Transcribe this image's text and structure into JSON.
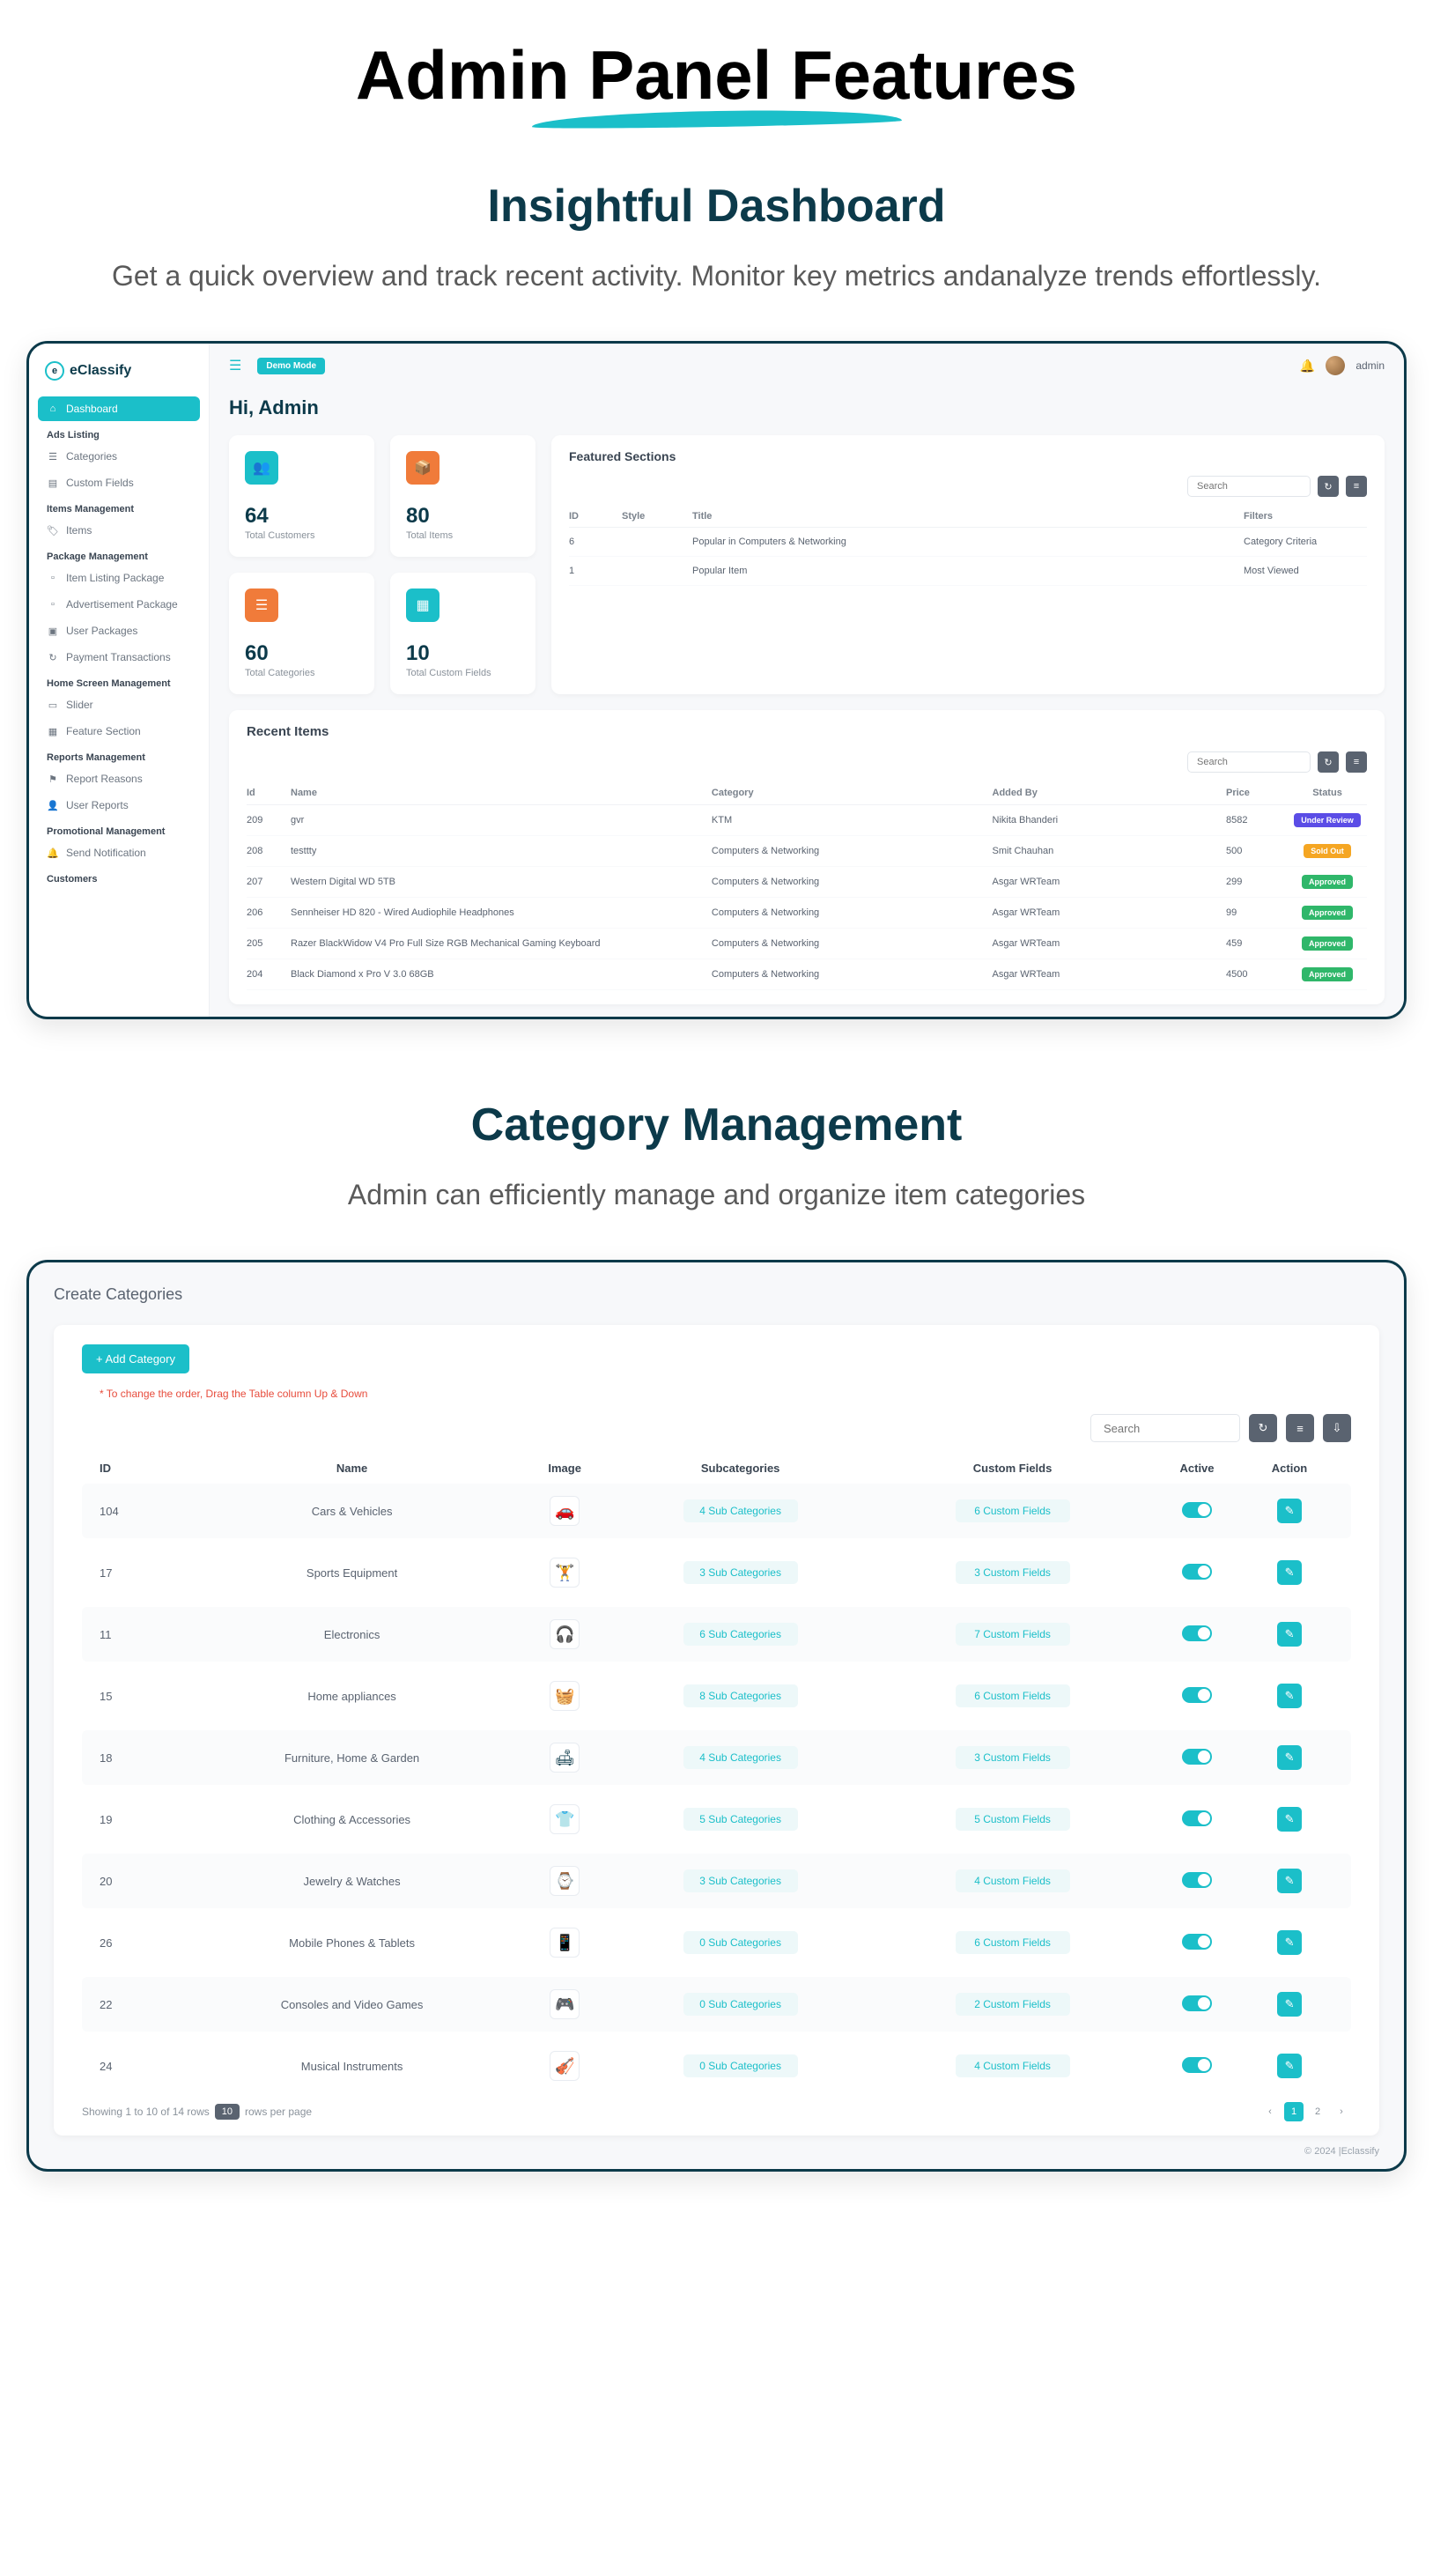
{
  "hero": "Admin Panel Features",
  "section1": {
    "title": "Insightful Dashboard",
    "sub": "Get a quick overview and track recent activity. Monitor key metrics andanalyze trends effortlessly."
  },
  "dashboard": {
    "logo": "eClassify",
    "demo": "Demo Mode",
    "admin": "admin",
    "sidebar": {
      "dashboard": "Dashboard",
      "h1": "Ads Listing",
      "categories": "Categories",
      "customFields": "Custom Fields",
      "h2": "Items Management",
      "items": "Items",
      "h3": "Package Management",
      "itemListing": "Item Listing Package",
      "adsPackage": "Advertisement Package",
      "userPackages": "User Packages",
      "payment": "Payment Transactions",
      "h4": "Home Screen Management",
      "slider": "Slider",
      "feature": "Feature Section",
      "h5": "Reports Management",
      "reportReasons": "Report Reasons",
      "userReports": "User Reports",
      "h6": "Promotional Management",
      "sendNotif": "Send Notification",
      "h7": "Customers"
    },
    "greeting": "Hi, Admin",
    "stats": {
      "customers": {
        "num": "64",
        "lbl": "Total Customers"
      },
      "items": {
        "num": "80",
        "lbl": "Total Items"
      },
      "categories": {
        "num": "60",
        "lbl": "Total Categories"
      },
      "customFields": {
        "num": "10",
        "lbl": "Total Custom Fields"
      }
    },
    "featured": {
      "title": "Featured Sections",
      "searchPh": "Search",
      "cols": {
        "id": "ID",
        "style": "Style",
        "title": "Title",
        "filters": "Filters"
      },
      "rows": [
        {
          "id": "6",
          "title": "Popular in Computers & Networking",
          "filters": "Category Criteria"
        },
        {
          "id": "1",
          "title": "Popular Item",
          "filters": "Most Viewed"
        }
      ]
    },
    "recent": {
      "title": "Recent Items",
      "searchPh": "Search",
      "cols": {
        "id": "Id",
        "name": "Name",
        "category": "Category",
        "by": "Added By",
        "price": "Price",
        "status": "Status"
      },
      "rows": [
        {
          "id": "209",
          "name": "gvr",
          "cat": "KTM",
          "by": "Nikita Bhanderi",
          "price": "8582",
          "status": "Under Review",
          "cls": "b-review"
        },
        {
          "id": "208",
          "name": "testtty",
          "cat": "Computers & Networking",
          "by": "Smit Chauhan",
          "price": "500",
          "status": "Sold Out",
          "cls": "b-soldout"
        },
        {
          "id": "207",
          "name": "Western Digital WD 5TB",
          "cat": "Computers & Networking",
          "by": "Asgar WRTeam",
          "price": "299",
          "status": "Approved",
          "cls": "b-approved"
        },
        {
          "id": "206",
          "name": "Sennheiser HD 820 - Wired Audiophile Headphones",
          "cat": "Computers & Networking",
          "by": "Asgar WRTeam",
          "price": "99",
          "status": "Approved",
          "cls": "b-approved"
        },
        {
          "id": "205",
          "name": "Razer BlackWidow V4 Pro Full Size RGB Mechanical Gaming Keyboard",
          "cat": "Computers & Networking",
          "by": "Asgar WRTeam",
          "price": "459",
          "status": "Approved",
          "cls": "b-approved"
        },
        {
          "id": "204",
          "name": "Black Diamond x Pro V 3.0 68GB",
          "cat": "Computers & Networking",
          "by": "Asgar WRTeam",
          "price": "4500",
          "status": "Approved",
          "cls": "b-approved"
        }
      ]
    }
  },
  "section2": {
    "title": "Category Management",
    "sub": "Admin can efficiently manage and organize item categories"
  },
  "categories": {
    "pageTitle": "Create Categories",
    "addBtn": "+ Add Category",
    "hint": "* To change the order, Drag the Table column Up & Down",
    "searchPh": "Search",
    "cols": {
      "id": "ID",
      "name": "Name",
      "image": "Image",
      "sub": "Subcategories",
      "cf": "Custom Fields",
      "active": "Active",
      "action": "Action"
    },
    "rows": [
      {
        "id": "104",
        "name": "Cars & Vehicles",
        "icon": "🚗",
        "sub": "4 Sub Categories",
        "cf": "6 Custom Fields"
      },
      {
        "id": "17",
        "name": "Sports Equipment",
        "icon": "🏋",
        "sub": "3 Sub Categories",
        "cf": "3 Custom Fields"
      },
      {
        "id": "11",
        "name": "Electronics",
        "icon": "🎧",
        "sub": "6 Sub Categories",
        "cf": "7 Custom Fields"
      },
      {
        "id": "15",
        "name": "Home appliances",
        "icon": "🧺",
        "sub": "8 Sub Categories",
        "cf": "6 Custom Fields"
      },
      {
        "id": "18",
        "name": "Furniture, Home & Garden",
        "icon": "🛋",
        "sub": "4 Sub Categories",
        "cf": "3 Custom Fields"
      },
      {
        "id": "19",
        "name": "Clothing & Accessories",
        "icon": "👕",
        "sub": "5 Sub Categories",
        "cf": "5 Custom Fields"
      },
      {
        "id": "20",
        "name": "Jewelry & Watches",
        "icon": "⌚",
        "sub": "3 Sub Categories",
        "cf": "4 Custom Fields"
      },
      {
        "id": "26",
        "name": "Mobile Phones & Tablets",
        "icon": "📱",
        "sub": "0 Sub Categories",
        "cf": "6 Custom Fields"
      },
      {
        "id": "22",
        "name": "Consoles and Video Games",
        "icon": "🎮",
        "sub": "0 Sub Categories",
        "cf": "2 Custom Fields"
      },
      {
        "id": "24",
        "name": "Musical Instruments",
        "icon": "🎻",
        "sub": "0 Sub Categories",
        "cf": "4 Custom Fields"
      }
    ],
    "pagi": {
      "showing": "Showing 1 to 10 of 14 rows",
      "per": "10",
      "perLbl": "rows per page",
      "pages": [
        "1",
        "2"
      ]
    },
    "footer": "© 2024 |Eclassify"
  }
}
